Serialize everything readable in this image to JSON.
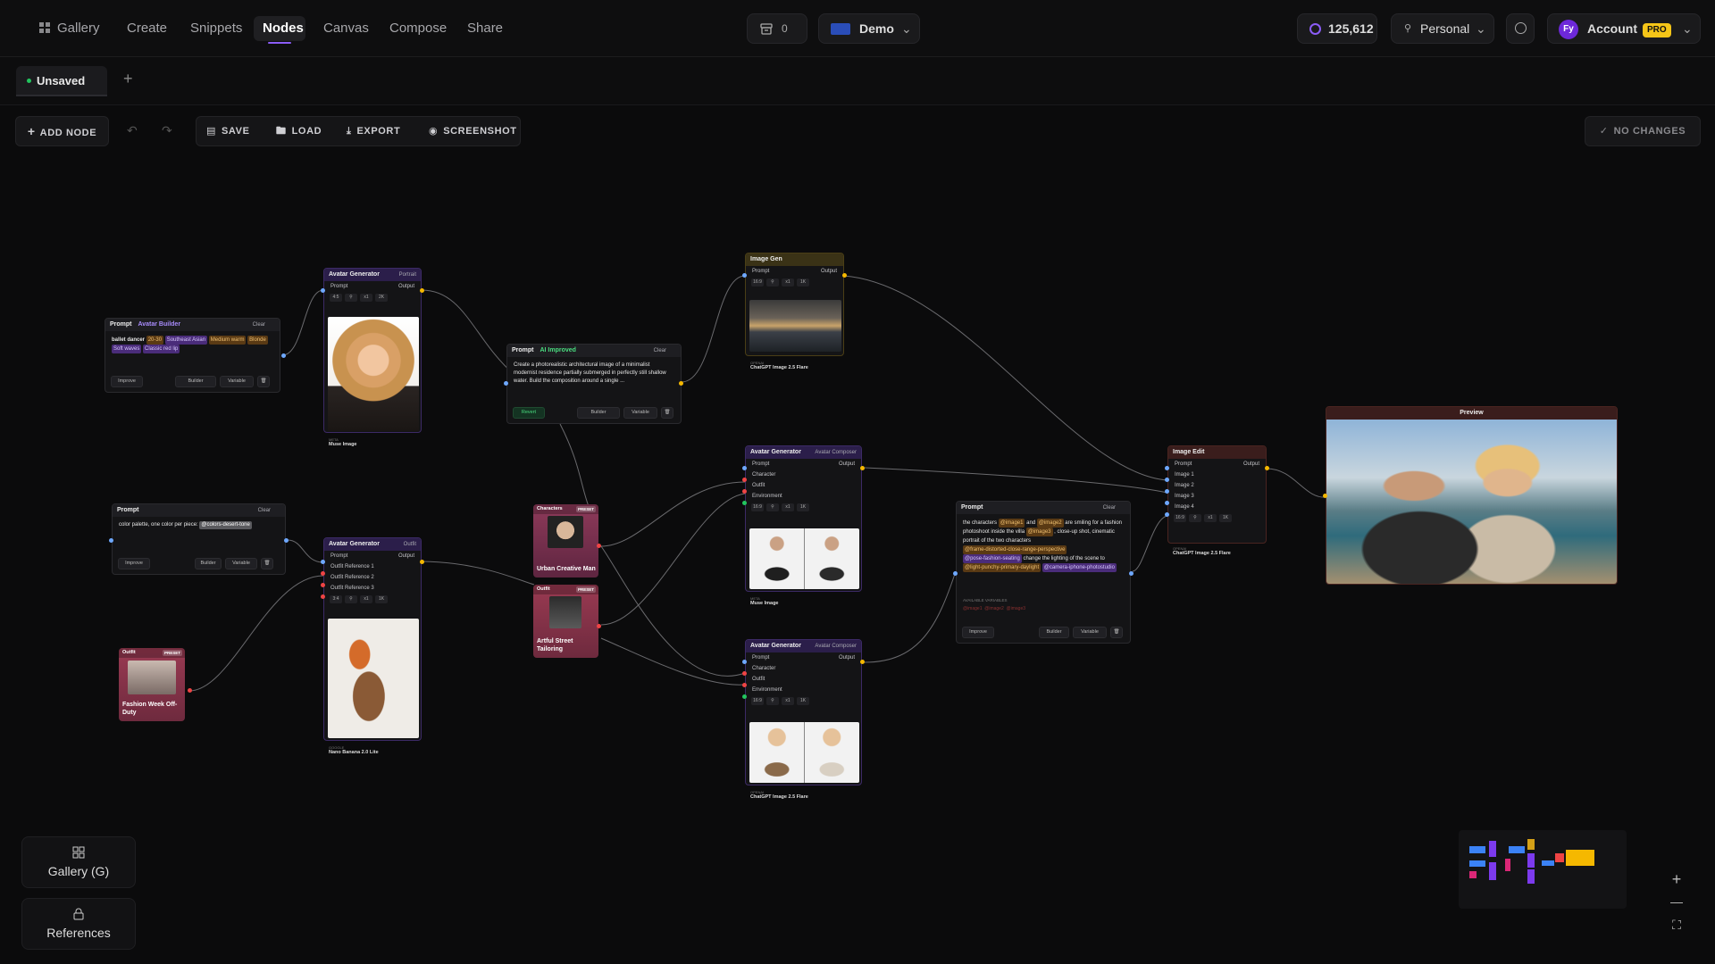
{
  "nav": {
    "items": [
      {
        "label": "Gallery"
      },
      {
        "label": "Create"
      },
      {
        "label": "Snippets"
      },
      {
        "label": "Nodes"
      },
      {
        "label": "Canvas"
      },
      {
        "label": "Compose"
      },
      {
        "label": "Share"
      }
    ],
    "active": "Nodes",
    "cart_count": "0",
    "workspace": "Demo",
    "credits": "125,612",
    "scope": "Personal",
    "account_label": "Account",
    "account_initials": "Fy",
    "pro_badge": "PRO"
  },
  "tabs": {
    "current": "Unsaved",
    "add": "+"
  },
  "toolbar": {
    "add_node": "ADD NODE",
    "save": "SAVE",
    "load": "LOAD",
    "export": "EXPORT",
    "screenshot": "SCREENSHOT",
    "status": "NO CHANGES"
  },
  "nodes": {
    "prompt1": {
      "title": "Prompt",
      "subtitle": "Avatar Builder",
      "clear": "Clear",
      "lead": "ballet dancer",
      "chips": [
        "20-30",
        "Southeast Asian",
        "Medium warm",
        "Blonde",
        "Soft waves",
        "Classic red lip"
      ],
      "improve": "Improve",
      "builder": "Builder",
      "variable": "Variable"
    },
    "avatar1": {
      "title": "Avatar Generator",
      "tag": "Portrait",
      "prompt": "Prompt",
      "output": "Output",
      "ctrl": [
        "4:5",
        "x1",
        "2K"
      ],
      "model_kind": "META",
      "model": "Muse Image"
    },
    "prompt2": {
      "title": "Prompt",
      "badge": "AI Improved",
      "clear": "Clear",
      "text": "Create a photorealistic architectural image of a minimalist modernist residence partially submerged in perfectly still shallow water. Build the composition around a single ...",
      "revert": "Revert",
      "builder": "Builder",
      "variable": "Variable"
    },
    "imagegen": {
      "title": "Image Gen",
      "prompt": "Prompt",
      "output": "Output",
      "ctrl": [
        "16:9",
        "x1",
        "1K"
      ],
      "model_kind": "OPENAI",
      "model": "ChatGPT Image 2.5 Flare"
    },
    "prompt3": {
      "title": "Prompt",
      "clear": "Clear",
      "text": "color palette, one color per piece:",
      "chip": "@colors-desert-tone",
      "improve": "Improve",
      "builder": "Builder",
      "variable": "Variable"
    },
    "avatar2": {
      "title": "Avatar Generator",
      "tag": "Outfit",
      "prompt": "Prompt",
      "output": "Output",
      "refs": [
        "Outfit Reference 1",
        "Outfit Reference 2",
        "Outfit Reference 3"
      ],
      "ctrl": [
        "3:4",
        "x1",
        "1K"
      ],
      "model_kind": "GOOGLE",
      "model": "Nano Banana 2.0 Lite"
    },
    "outfit1": {
      "head": "Outfit",
      "badge": "PRESET",
      "label": "Fashion Week Off-Duty"
    },
    "character": {
      "head": "Characters",
      "badge": "PRESET",
      "label": "Urban Creative Man"
    },
    "outfit2": {
      "head": "Outfit",
      "badge": "PRESET",
      "label": "Artful Street Tailoring"
    },
    "composer1": {
      "title": "Avatar Generator",
      "tag": "Avatar Composer",
      "inputs": [
        "Prompt",
        "Character",
        "Outfit",
        "Environment"
      ],
      "output": "Output",
      "ctrl": [
        "16:9",
        "x1",
        "1K"
      ],
      "model_kind": "META",
      "model": "Muse Image"
    },
    "composer2": {
      "title": "Avatar Generator",
      "tag": "Avatar Composer",
      "inputs": [
        "Prompt",
        "Character",
        "Outfit",
        "Environment"
      ],
      "output": "Output",
      "ctrl": [
        "16:9",
        "x1",
        "1K"
      ],
      "model_kind": "OPENAI",
      "model": "ChatGPT Image 2.5 Flare"
    },
    "prompt4": {
      "title": "Prompt",
      "clear": "Clear",
      "t1": "the characters",
      "c1": "@image1",
      "t2": "and",
      "c2": "@image2",
      "t3": "are smiling for a fashion photoshoot inside the villa",
      "c3": "@image3",
      "t4": ", close-up shot, cinematic portrait of the two characters",
      "c4": "@frame-distorted-close-range-perspective",
      "c5": "@pose-fashion-seating",
      "t5": "change the lighting of the scene to",
      "c6": "@light-punchy-primary-daylight",
      "c7": "@camera-iphone-photostudio",
      "vars_label": "AVAILABLE VARIABLES",
      "vars": [
        "@image1",
        "@image2",
        "@image3"
      ],
      "improve": "Improve",
      "builder": "Builder",
      "variable": "Variable"
    },
    "imageedit": {
      "title": "Image Edit",
      "inputs": [
        "Prompt",
        "Image 1",
        "Image 2",
        "Image 3",
        "Image 4"
      ],
      "output": "Output",
      "ctrl": [
        "16:9",
        "x1",
        "1K"
      ],
      "model_kind": "OPENAI",
      "model": "ChatGPT Image 2.5 Flare"
    },
    "preview": {
      "title": "Preview"
    }
  },
  "sidebar": {
    "gallery": "Gallery (G)",
    "references": "References"
  },
  "zoom": {
    "in": "+",
    "out": "—",
    "fit": "⛶"
  },
  "colors": {
    "accent": "#8b5cf6",
    "gold": "#f5c518",
    "port_yellow": "#f5b800",
    "port_blue": "#6ea8ff",
    "port_red": "#ef4444",
    "port_green": "#22c55e"
  }
}
